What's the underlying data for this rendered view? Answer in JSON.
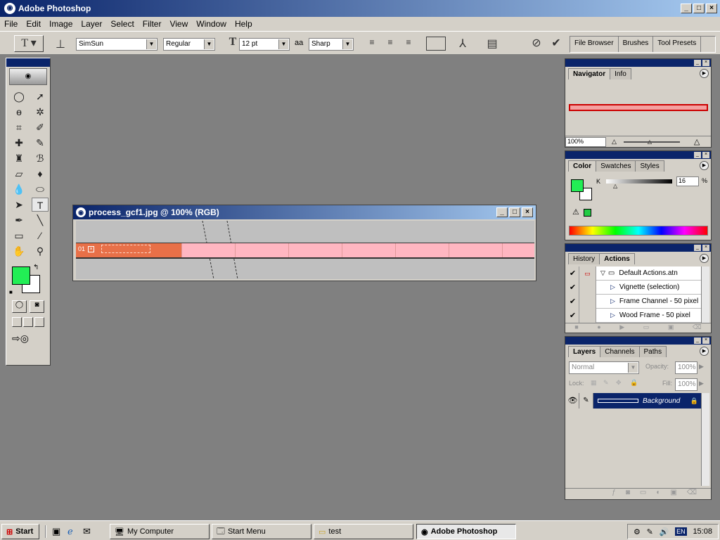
{
  "window": {
    "title": "Adobe Photoshop"
  },
  "menu": [
    "File",
    "Edit",
    "Image",
    "Layer",
    "Select",
    "Filter",
    "View",
    "Window",
    "Help"
  ],
  "options": {
    "font_family": "SimSun",
    "font_style": "Regular",
    "font_size": "12 pt",
    "anti_alias": "Sharp",
    "aa_label": "aa"
  },
  "well": [
    "File Browser",
    "Brushes",
    "Tool Presets"
  ],
  "image_window": {
    "title": "process_gcf1.jpg @ 100% (RGB)",
    "row_number": "01"
  },
  "navigator": {
    "tabs": [
      "Navigator",
      "Info"
    ],
    "zoom": "100%"
  },
  "color": {
    "tabs": [
      "Color",
      "Swatches",
      "Styles"
    ],
    "channel": "K",
    "value": "16",
    "unit": "%",
    "foreground": "#22ee55",
    "background": "#ffffff"
  },
  "actions": {
    "tabs": [
      "History",
      "Actions"
    ],
    "items": [
      "Default Actions.atn",
      "Vignette (selection)",
      "Frame Channel - 50 pixel",
      "Wood Frame - 50 pixel"
    ]
  },
  "layers": {
    "tabs": [
      "Layers",
      "Channels",
      "Paths"
    ],
    "blend_mode": "Normal",
    "opacity_label": "Opacity:",
    "opacity": "100%",
    "lock_label": "Lock:",
    "fill_label": "Fill:",
    "fill": "100%",
    "layer_name": "Background"
  },
  "taskbar": {
    "start": "Start",
    "tasks": [
      "My Computer",
      "Start Menu",
      "test",
      "Adobe Photoshop"
    ],
    "lang": "EN",
    "time": "15:08"
  }
}
